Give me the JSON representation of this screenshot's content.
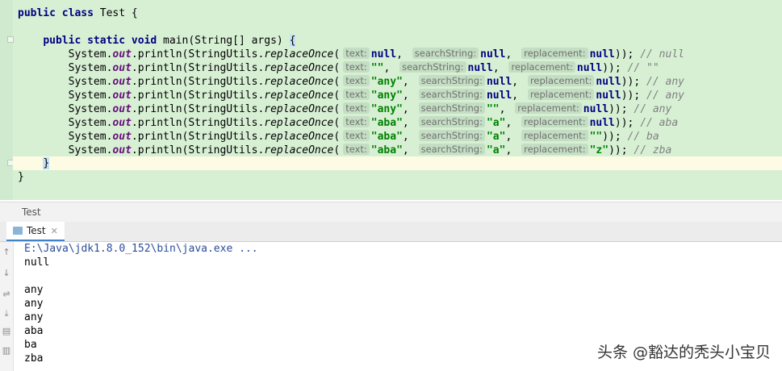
{
  "editor": {
    "class_line": {
      "kw": "public class ",
      "name": "Test {"
    },
    "main_line": {
      "kw": "public static void ",
      "rest": "main(String[] args) ",
      "brace": "{"
    },
    "prefix": {
      "sys": "System.",
      "out": "out",
      "mid": ".println(StringUtils.",
      "method": "replaceOnce",
      "paren": "("
    },
    "hint_labels": {
      "text": "text:",
      "search": "searchString:",
      "repl": "replacement:"
    },
    "calls": [
      {
        "a": "null",
        "b": "null",
        "c": "null",
        "tail": ")); ",
        "comment": "// null"
      },
      {
        "a": "\"\"",
        "b": "null",
        "c": "null",
        "tail": ")); ",
        "comment": "// \"\""
      },
      {
        "a": "\"any\"",
        "b": "null",
        "c": "null",
        "tail": ")); ",
        "comment": "// any"
      },
      {
        "a": "\"any\"",
        "b": "null",
        "c": "null",
        "tail": ")); ",
        "comment": "// any"
      },
      {
        "a": "\"any\"",
        "b": "\"\"",
        "c": "null",
        "tail": ")); ",
        "comment": "// any"
      },
      {
        "a": "\"aba\"",
        "b": "\"a\"",
        "c": "null",
        "tail": ")); ",
        "comment": "// aba"
      },
      {
        "a": "\"aba\"",
        "b": "\"a\"",
        "c": "\"\"",
        "tail": ")); ",
        "comment": "// ba"
      },
      {
        "a": "\"aba\"",
        "b": "\"a\"",
        "c": "\"z\"",
        "tail": ")); ",
        "comment": "// zba"
      }
    ],
    "close_method": "}",
    "close_class": "}"
  },
  "status": {
    "label": "Test"
  },
  "run_panel": {
    "tab_label": "Test",
    "close_icon": "close-icon",
    "toolbar_icons": [
      "arrow-up-icon",
      "arrow-down-icon",
      "soft-wrap-icon",
      "scroll-to-end-icon",
      "print-icon",
      "trash-icon"
    ],
    "command": "E:\\Java\\jdk1.8.0_152\\bin\\java.exe ...",
    "output": [
      "null",
      "",
      "any",
      "any",
      "any",
      "aba",
      "ba",
      "zba"
    ]
  },
  "watermark": "头条 @豁达的秃头小宝贝",
  "colors": {
    "editor_bg": "#d7f0d4",
    "keyword": "#000080",
    "string": "#008000",
    "static_field": "#660e7a",
    "comment": "#808080",
    "current_line": "#fdfbe3"
  }
}
